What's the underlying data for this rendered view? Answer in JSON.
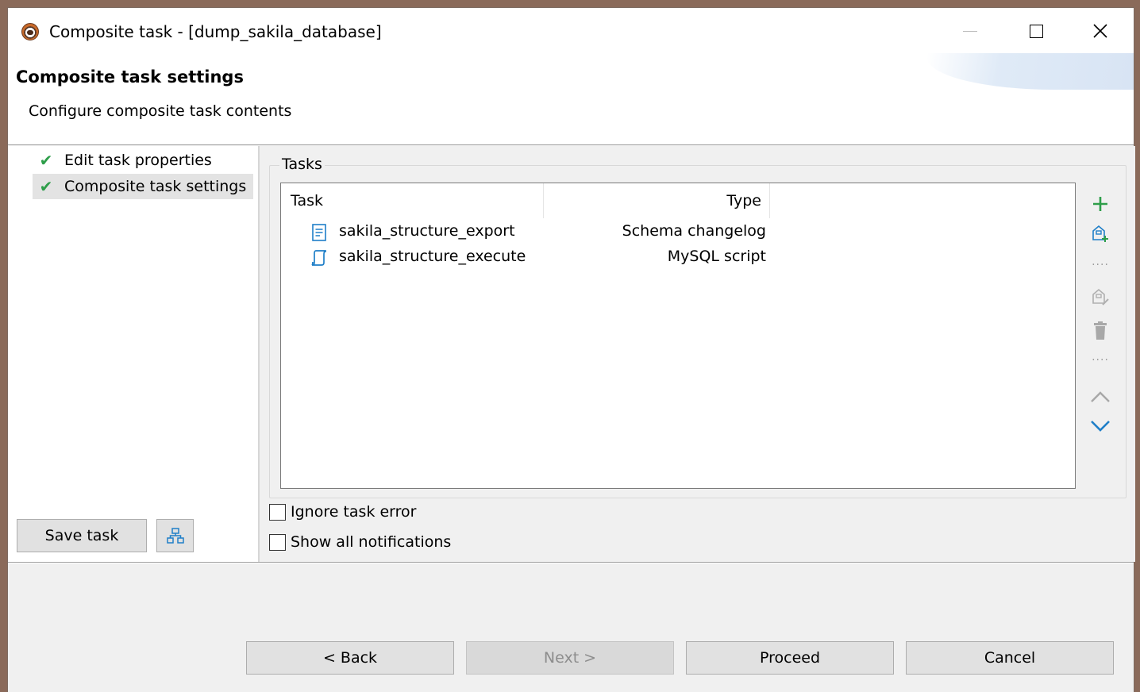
{
  "window": {
    "title": "Composite task - [dump_sakila_database]",
    "app_icon": "dbeaver-beaver-icon"
  },
  "banner": {
    "title": "Composite task settings",
    "description": "Configure composite task contents"
  },
  "sidebar": {
    "items": [
      {
        "label": "Edit task properties",
        "icon": "check-icon",
        "selected": false
      },
      {
        "label": "Composite task settings",
        "icon": "check-icon",
        "selected": true
      }
    ],
    "check_glyph": "✔",
    "save_task_label": "Save task",
    "tree_button_icon": "hierarchy-icon"
  },
  "tasks_group": {
    "label": "Tasks",
    "columns": {
      "task": "Task",
      "type": "Type"
    },
    "rows": [
      {
        "task": "sakila_structure_export",
        "type": "Schema changelog",
        "icon": "document-icon"
      },
      {
        "task": "sakila_structure_execute",
        "type": "MySQL script",
        "icon": "script-icon"
      }
    ],
    "toolbar": {
      "add": "add-icon",
      "create": "create-task-icon",
      "separator": "....",
      "edit": "edit-task-icon",
      "delete": "delete-icon",
      "move_up": "chevron-up-icon",
      "move_down": "chevron-down-icon"
    }
  },
  "options": {
    "ignore_task_error": {
      "label": "Ignore task error",
      "checked": false
    },
    "show_all_notifications": {
      "label": "Show all notifications",
      "checked": false
    }
  },
  "buttons": {
    "back": "< Back",
    "next": "Next >",
    "proceed": "Proceed",
    "cancel": "Cancel"
  },
  "colors": {
    "check_green": "#2e9e4a",
    "add_green": "#2e9e4a",
    "icon_blue": "#1f7fc8",
    "disabled_text": "#8d8d8d"
  }
}
